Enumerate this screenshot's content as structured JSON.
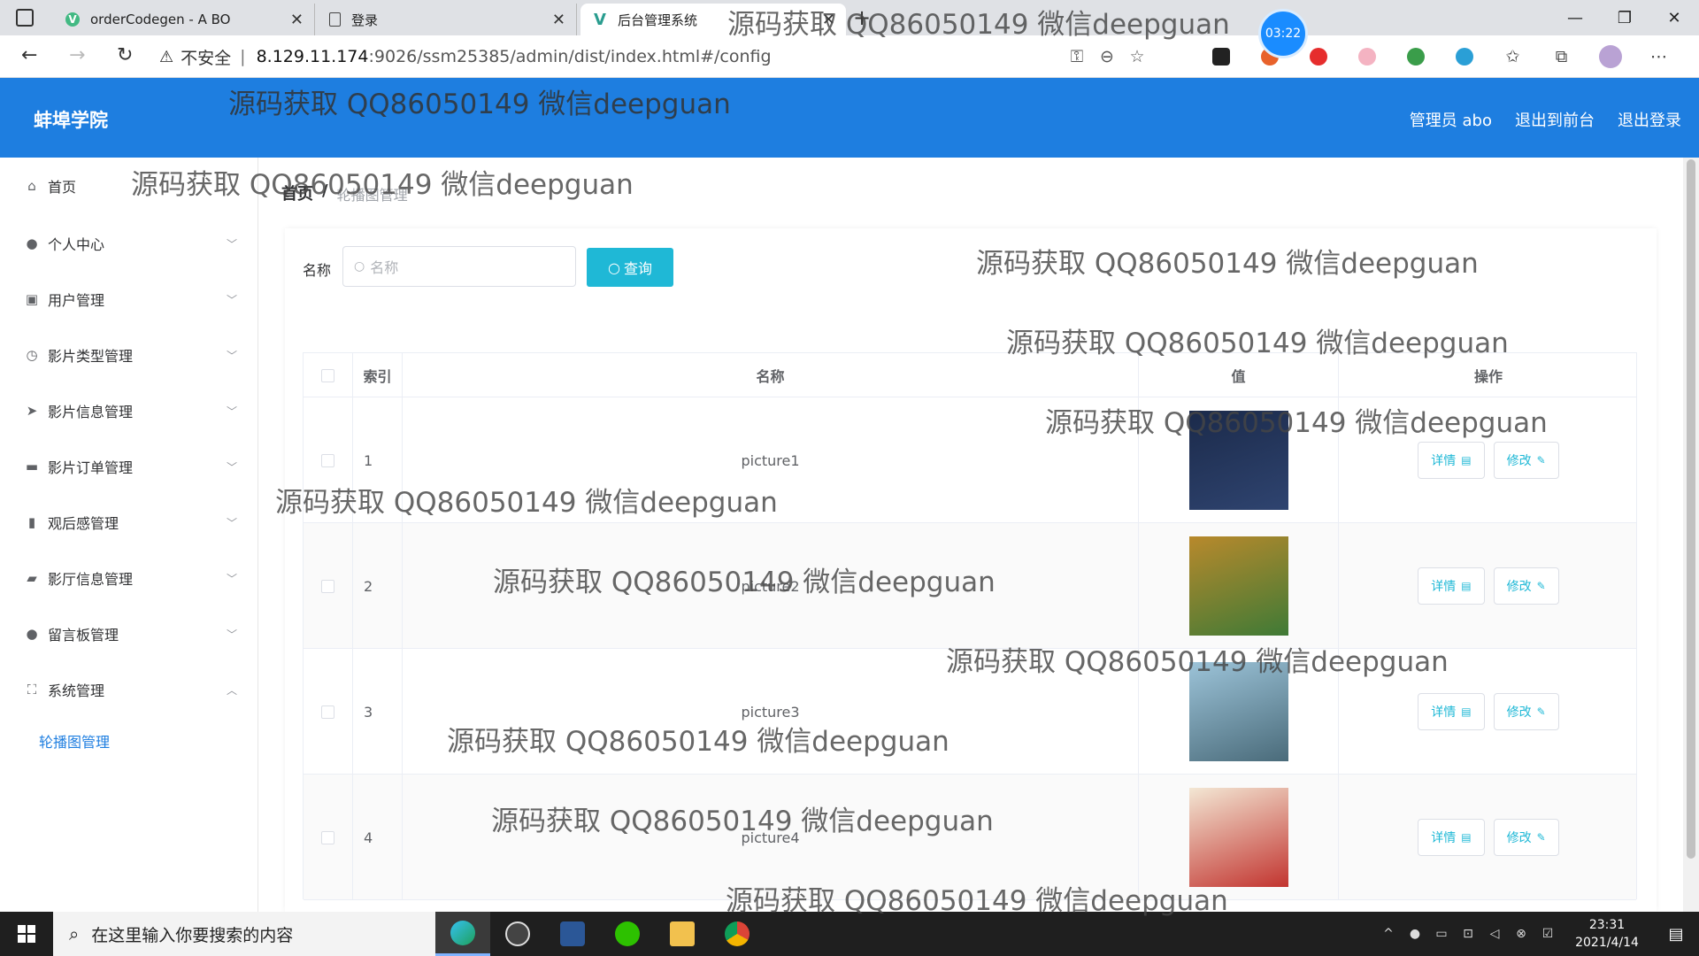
{
  "browser": {
    "tabs": [
      {
        "title": "orderCodegen - A BO"
      },
      {
        "title": "登录"
      },
      {
        "title": "后台管理系统"
      }
    ],
    "timer": "03:22",
    "url_warning": "不安全",
    "url_host": "8.129.11.174",
    "url_path": ":9026/ssm25385/admin/dist/index.html#/config"
  },
  "header": {
    "brand": "蚌埠学院",
    "admin_label": "管理员 abo",
    "to_front": "退出到前台",
    "logout": "退出登录"
  },
  "sidebar": {
    "items": [
      {
        "label": "首页",
        "icon": "home-icon"
      },
      {
        "label": "个人中心",
        "icon": "user-icon"
      },
      {
        "label": "用户管理",
        "icon": "chart-icon"
      },
      {
        "label": "影片类型管理",
        "icon": "clock-icon"
      },
      {
        "label": "影片信息管理",
        "icon": "send-icon"
      },
      {
        "label": "影片订单管理",
        "icon": "briefcase-icon"
      },
      {
        "label": "观后感管理",
        "icon": "bar-chart-icon"
      },
      {
        "label": "影厅信息管理",
        "icon": "chat-icon"
      },
      {
        "label": "留言板管理",
        "icon": "pin-icon"
      },
      {
        "label": "系统管理",
        "icon": "fullscreen-icon"
      }
    ],
    "sub_item": "轮播图管理"
  },
  "breadcrumb": {
    "home": "首页",
    "separator": "/",
    "current": "轮播图管理"
  },
  "search": {
    "label": "名称",
    "placeholder": "名称",
    "button": "查询"
  },
  "table": {
    "headers": [
      "索引",
      "名称",
      "值",
      "操作"
    ],
    "rows": [
      {
        "index": "1",
        "name": "picture1",
        "thumb_colors": [
          "#1b2a4a",
          "#2f4470"
        ]
      },
      {
        "index": "2",
        "name": "picture2",
        "thumb_colors": [
          "#b8892c",
          "#3f7a36"
        ]
      },
      {
        "index": "3",
        "name": "picture3",
        "thumb_colors": [
          "#9cc3d8",
          "#4a6b7a"
        ]
      },
      {
        "index": "4",
        "name": "picture4",
        "thumb_colors": [
          "#f3e7d4",
          "#c2342f"
        ]
      }
    ],
    "detail_label": "详情",
    "edit_label": "修改"
  },
  "watermark": "源码获取 QQ86050149 微信deepguan",
  "taskbar": {
    "search_placeholder": "在这里输入你要搜索的内容",
    "time": "23:31",
    "date": "2021/4/14"
  },
  "colors": {
    "header_bg": "#1e7ee0",
    "accent": "#1fb8d6"
  }
}
